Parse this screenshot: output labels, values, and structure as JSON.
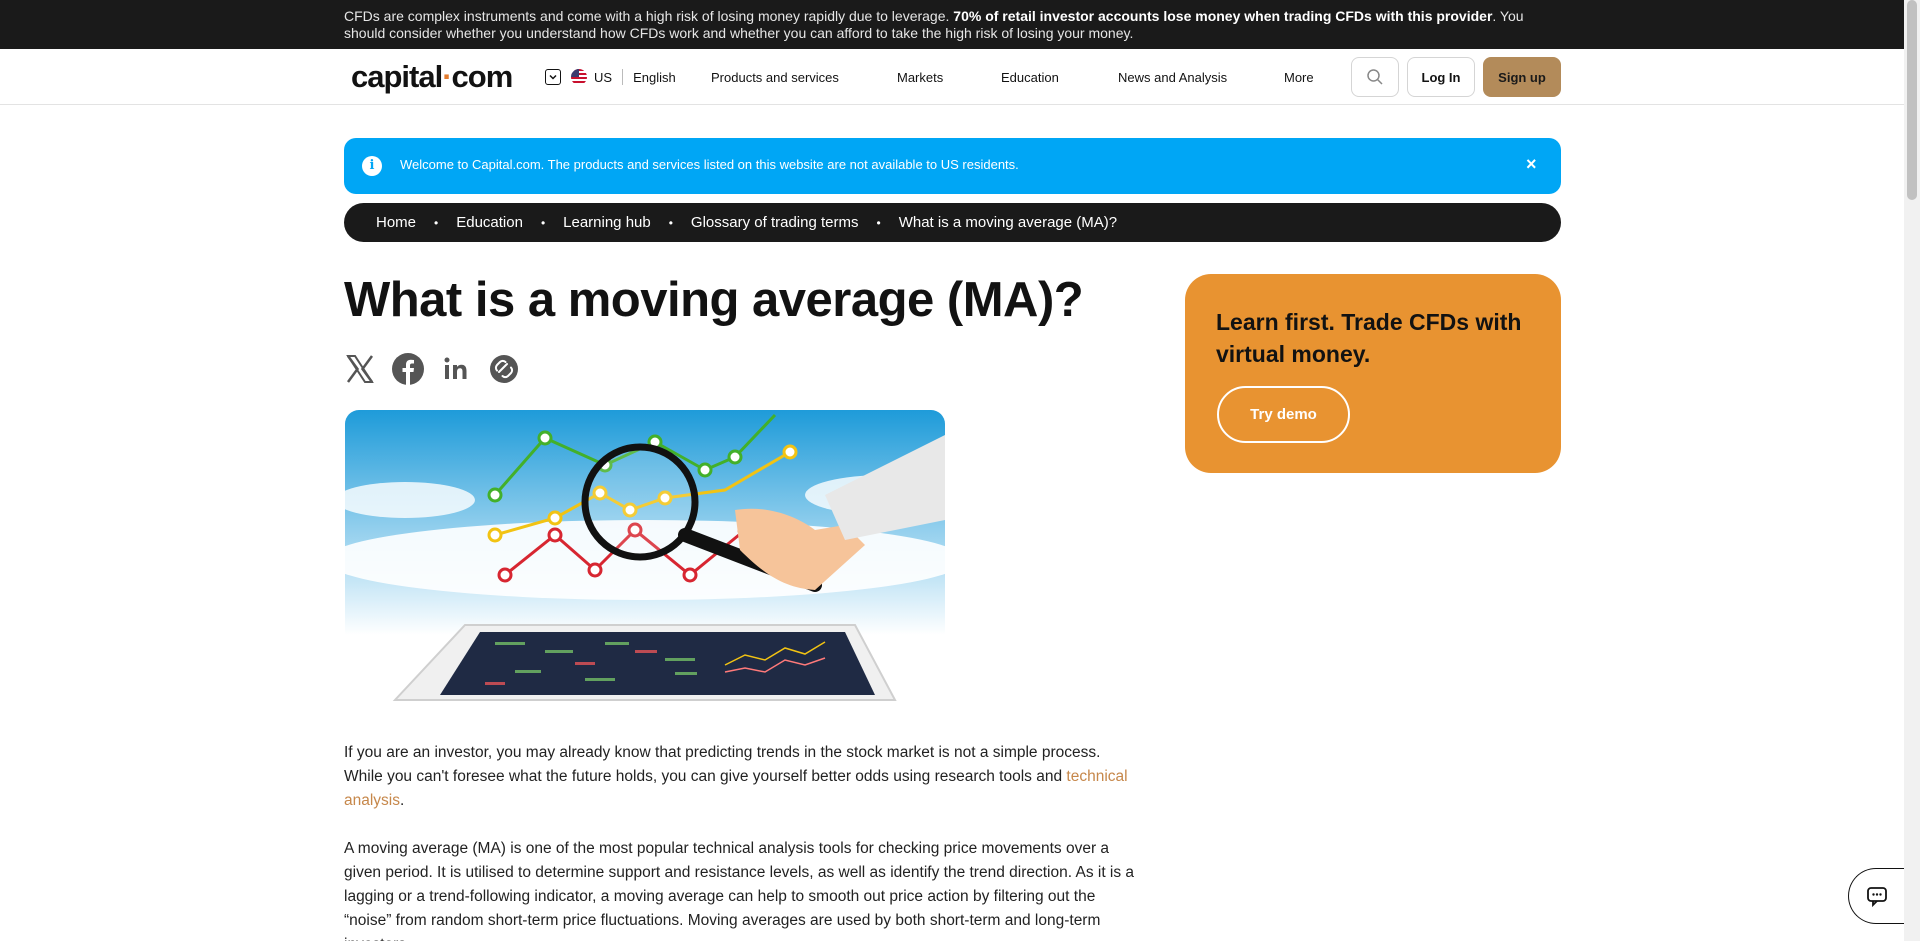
{
  "risk_warning": {
    "pre": "CFDs are complex instruments and come with a high risk of losing money rapidly due to leverage. ",
    "bold": "70% of retail investor accounts lose money when trading CFDs with this provider",
    "post": ". You should consider whether you understand how CFDs work and whether you can afford to take the high risk of losing your money."
  },
  "header": {
    "logo_main": "capital",
    "logo_dot": "·",
    "logo_end": "com",
    "region": "US",
    "language": "English",
    "nav": [
      "Products and services",
      "Markets",
      "Education",
      "News and Analysis",
      "More"
    ],
    "login_label": "Log In",
    "signup_label": "Sign up"
  },
  "notice": {
    "icon": "info-icon",
    "message": "Welcome to Capital.com. The products and services listed on this website are not available to US residents.",
    "close": "×"
  },
  "breadcrumb": [
    "Home",
    "Education",
    "Learning hub",
    "Glossary of trading terms",
    "What is a moving average (MA)?"
  ],
  "article": {
    "title": "What is a moving average (MA)?",
    "share_icons": [
      "x-icon",
      "facebook-icon",
      "linkedin-icon",
      "copy-link-icon"
    ],
    "para1_pre": "If you are an investor, you may already know that predicting trends in the stock market is not a simple process. While you can't foresee what the future holds, you can give yourself better odds using research tools and ",
    "para1_link": "technical analysis",
    "para1_post": ".",
    "para2": "A moving average (MA) is one of the most popular technical analysis tools for checking price movements over a given period. It is utilised to determine support and resistance levels, as well as identify the trend direction. As it is a lagging or a trend-following indicator, a moving average can help to smooth out price action by filtering out the “noise” from random short-term price fluctuations. Moving averages are used by both short-term and long-term investors."
  },
  "demo_card": {
    "heading": "Learn first. Trade CFDs with virtual money.",
    "button": "Try demo"
  },
  "colors": {
    "brand_orange": "#e89331",
    "notice_blue": "#00a6f5",
    "signup_tan": "#b38b5a",
    "dark": "#1a1a1a"
  }
}
